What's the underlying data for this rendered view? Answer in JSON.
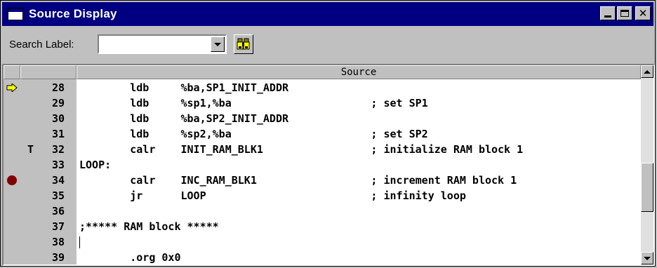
{
  "window": {
    "title": "Source Display"
  },
  "toolbar": {
    "search_label": "Search Label:",
    "search_value": ""
  },
  "source": {
    "column_header": "Source",
    "rows": [
      {
        "marker": "pc-arrow",
        "flag": "",
        "line": "28",
        "code": "        ldb     %ba,SP1_INIT_ADDR"
      },
      {
        "marker": "",
        "flag": "",
        "line": "29",
        "code": "        ldb     %sp1,%ba                      ; set SP1"
      },
      {
        "marker": "",
        "flag": "",
        "line": "30",
        "code": "        ldb     %ba,SP2_INIT_ADDR"
      },
      {
        "marker": "",
        "flag": "",
        "line": "31",
        "code": "        ldb     %sp2,%ba                      ; set SP2"
      },
      {
        "marker": "",
        "flag": "T",
        "line": "32",
        "code": "        calr    INIT_RAM_BLK1                 ; initialize RAM block 1"
      },
      {
        "marker": "",
        "flag": "",
        "line": "33",
        "code": "LOOP:"
      },
      {
        "marker": "breakpoint",
        "flag": "",
        "line": "34",
        "code": "        calr    INC_RAM_BLK1                  ; increment RAM block 1"
      },
      {
        "marker": "",
        "flag": "",
        "line": "35",
        "code": "        jr      LOOP                          ; infinity loop"
      },
      {
        "marker": "",
        "flag": "",
        "line": "36",
        "code": ""
      },
      {
        "marker": "",
        "flag": "",
        "line": "37",
        "code": ";***** RAM block *****"
      },
      {
        "marker": "",
        "flag": "",
        "line": "38",
        "code": ""
      },
      {
        "marker": "",
        "flag": "",
        "line": "39",
        "code": "        .org 0x0"
      }
    ]
  },
  "colors": {
    "title_bar": "#000080",
    "breakpoint": "#800000",
    "pc_arrow": "#ffff00"
  },
  "scrollbar": {
    "position_fraction": 0.68
  }
}
